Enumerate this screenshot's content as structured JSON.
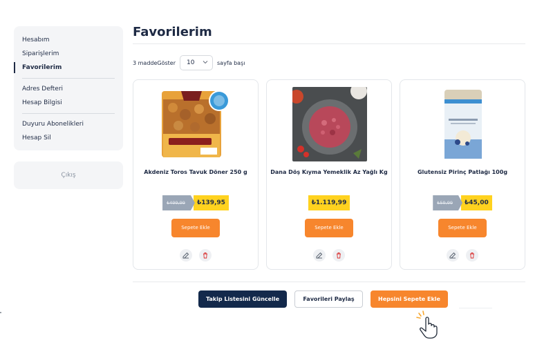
{
  "sidebar": {
    "items": [
      {
        "label": "Hesabım",
        "active": false
      },
      {
        "label": "Siparişlerim",
        "active": false
      },
      {
        "label": "Favorilerim",
        "active": true
      },
      {
        "label": "Adres Defteri",
        "active": false
      },
      {
        "label": "Hesap Bilgisi",
        "active": false
      },
      {
        "label": "Duyuru Abonelikleri",
        "active": false
      },
      {
        "label": "Hesap Sil",
        "active": false
      }
    ],
    "logout_label": "Çıkış"
  },
  "page": {
    "title": "Favorilerim"
  },
  "pager": {
    "count_text": "3 madde",
    "show_label": "Göster",
    "per_page_value": "10",
    "suffix": "sayfa başı"
  },
  "products": [
    {
      "name": "Akdeniz Toros Tavuk Döner 250 g",
      "old_price": "₺499,99",
      "price": "₺139,95",
      "add_label": "Sepete Ekle",
      "image": "tavuk-doner-package"
    },
    {
      "name": "Dana Döş Kıyma Yemeklik Az Yağlı Kg",
      "old_price": "",
      "price": "₺1.119,99",
      "add_label": "Sepete Ekle",
      "image": "minced-meat-plate"
    },
    {
      "name": "Glutensiz Pirinç Patlağı 100g",
      "old_price": "₺59,99",
      "price": "₺45,00",
      "add_label": "Sepete Ekle",
      "image": "rice-cake-pack"
    }
  ],
  "actions": {
    "update_label": "Takip Listesini Güncelle",
    "share_label": "Favorileri Paylaş",
    "add_all_label": "Hepsini Sepete Ekle"
  },
  "colors": {
    "navy": "#13294b",
    "orange": "#f7862d",
    "price_yellow": "#ffd21f",
    "old_price_gray": "#9aa6b6"
  },
  "icons": [
    "edit-icon",
    "trash-icon",
    "pointer-hand-icon",
    "chevron-down-icon"
  ]
}
